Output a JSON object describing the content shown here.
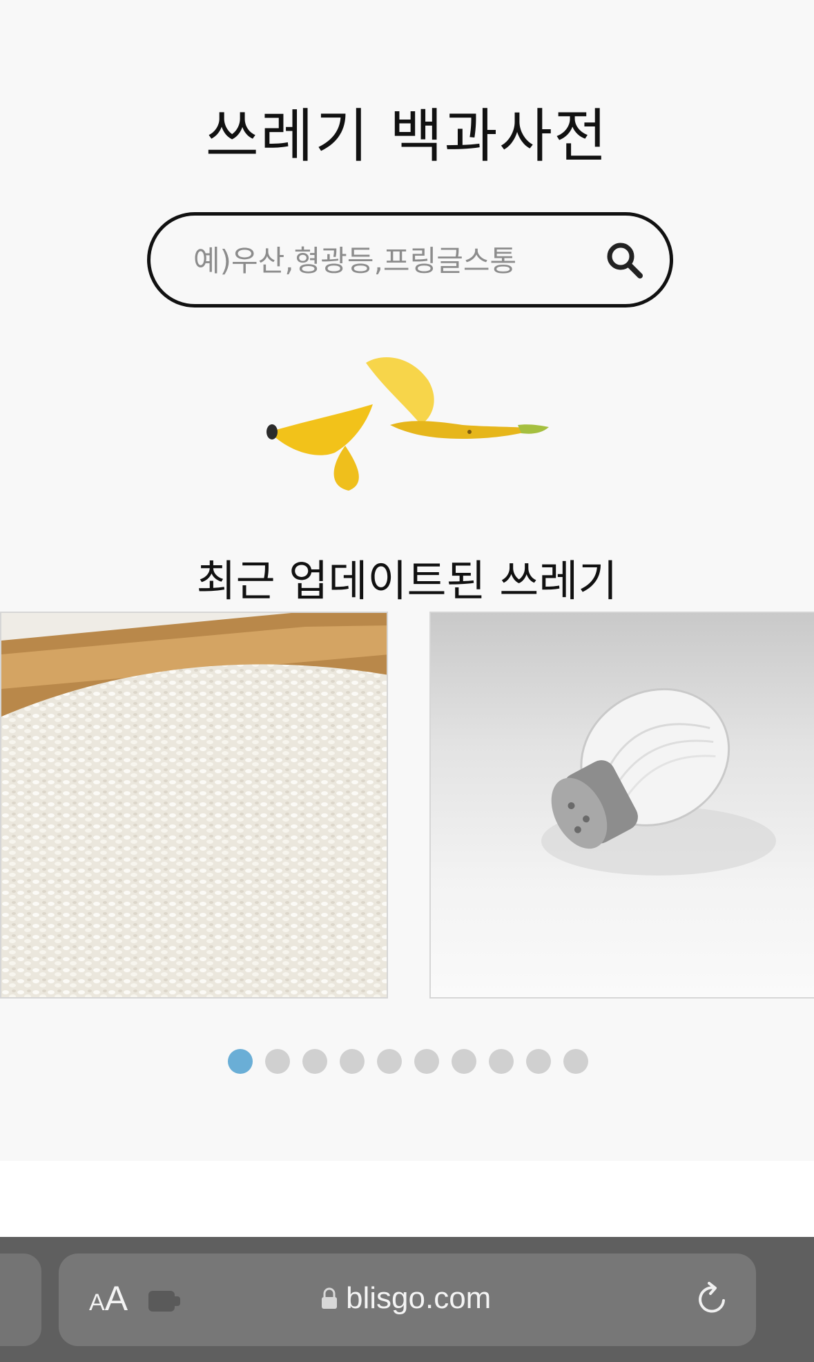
{
  "page": {
    "title": "쓰레기 백과사전",
    "search": {
      "placeholder": "예)우산,형광등,프링글스통"
    },
    "recent_heading": "최근 업데이트된 쓰레기",
    "carousel": {
      "slides": [
        {
          "name": "rice"
        },
        {
          "name": "salt-shaker"
        }
      ],
      "dot_count": 10,
      "active_index": 0
    }
  },
  "browser": {
    "text_size_small": "A",
    "text_size_big": "A",
    "url": "blisgo.com"
  },
  "colors": {
    "active_dot": "#6aaed6",
    "inactive_dot": "#d0d0d0",
    "browser_bar": "#5f5f5f"
  },
  "icons": [
    "search-icon",
    "banana-peel-image",
    "lock-icon",
    "extension-icon",
    "reload-icon"
  ]
}
